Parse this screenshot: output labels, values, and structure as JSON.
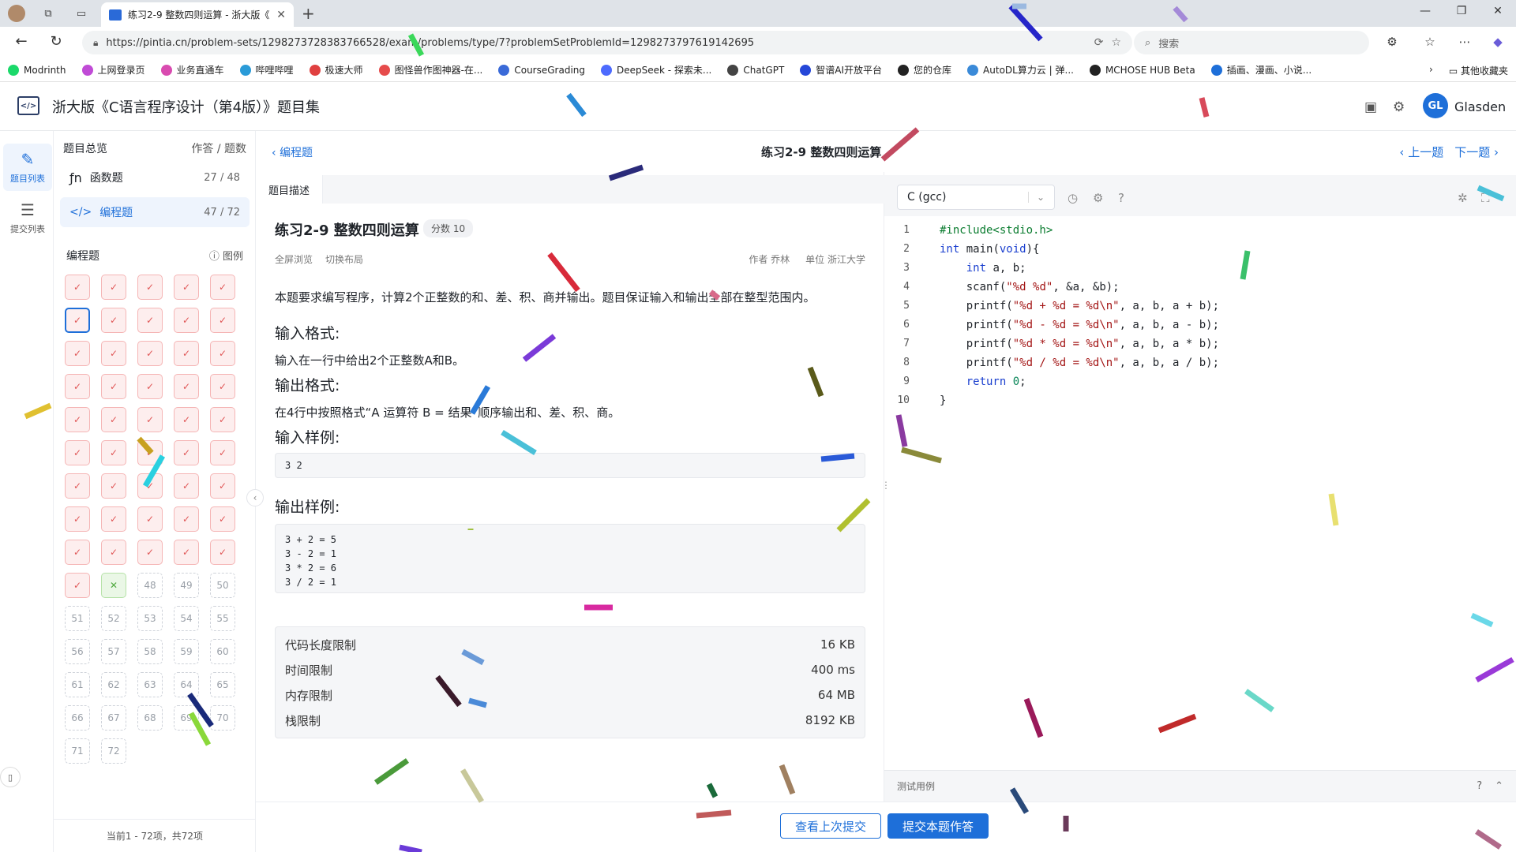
{
  "browser": {
    "tab_title": "练习2-9 整数四则运算 - 浙大版《",
    "url": "https://pintia.cn/problem-sets/1298273728383766528/exam/problems/type/7?problemSetProblemId=1298273797619142695",
    "search_placeholder": "搜索",
    "bookmarks": [
      {
        "label": "Modrinth",
        "color": "#1bd96a"
      },
      {
        "label": "上网登录页",
        "color": "#c04bd6"
      },
      {
        "label": "业务直通车",
        "color": "#d94bb0"
      },
      {
        "label": "哔哩哔哩",
        "color": "#2a9bd8"
      },
      {
        "label": "极速大师",
        "color": "#e04040"
      },
      {
        "label": "图怪兽作图神器-在...",
        "color": "#e64b4b"
      },
      {
        "label": "CourseGrading",
        "color": "#3a6ad8"
      },
      {
        "label": "DeepSeek - 探索未...",
        "color": "#4d6bfe"
      },
      {
        "label": "ChatGPT",
        "color": "#444444"
      },
      {
        "label": "智谱AI开放平台",
        "color": "#2547d8"
      },
      {
        "label": "您的仓库",
        "color": "#222222"
      },
      {
        "label": "AutoDL算力云 | 弹...",
        "color": "#3a8ad8"
      },
      {
        "label": "MCHOSE HUB Beta",
        "color": "#222222"
      },
      {
        "label": "插画、漫画、小说...",
        "color": "#1e6fd9"
      }
    ],
    "bookmarks_folder": "其他收藏夹"
  },
  "app": {
    "title": "浙大版《C语言程序设计（第4版）》题目集",
    "avatar_initials": "GL",
    "user_name": "Glasden",
    "accent_color": "#1e6fd9"
  },
  "rail": {
    "items": [
      {
        "label": "题目列表",
        "icon": "problem-list-icon"
      },
      {
        "label": "提交列表",
        "icon": "submission-list-icon"
      }
    ]
  },
  "problem_list": {
    "header": "题目总览",
    "header_right": "作答 / 题数",
    "types": [
      {
        "label": "函数题",
        "count": "27 / 48"
      },
      {
        "label": "编程题",
        "count": "47 / 72"
      }
    ],
    "grid_title": "编程题",
    "legend_label": "图例",
    "footer": "当前1 - 72项，共72项",
    "cells": [
      "pass",
      "pass",
      "pass",
      "pass",
      "pass",
      "sel",
      "pass",
      "pass",
      "pass",
      "pass",
      "pass",
      "pass",
      "pass",
      "pass",
      "pass",
      "pass",
      "pass",
      "pass",
      "pass",
      "pass",
      "pass",
      "pass",
      "pass",
      "pass",
      "pass",
      "pass",
      "pass",
      "pass",
      "pass",
      "pass",
      "pass",
      "pass",
      "pass",
      "pass",
      "pass",
      "pass",
      "pass",
      "pass",
      "pass",
      "pass",
      "pass",
      "pass",
      "pass",
      "pass",
      "pass",
      "pass",
      "fail",
      "48",
      "49",
      "50",
      "51",
      "52",
      "53",
      "54",
      "55",
      "56",
      "57",
      "58",
      "59",
      "60",
      "61",
      "62",
      "63",
      "64",
      "65",
      "66",
      "67",
      "68",
      "69",
      "70",
      "71",
      "72"
    ]
  },
  "top_strip": {
    "back": "编程题",
    "title": "练习2-9 整数四则运算",
    "prev": "上一题",
    "next": "下一题"
  },
  "description": {
    "tab": "题目描述",
    "title": "练习2-9 整数四则运算",
    "score": "分数 10",
    "fullscreen": "全屏浏览",
    "layout": "切换布局",
    "author": "作者 乔林",
    "unit": "单位 浙江大学",
    "statement": "本题要求编写程序，计算2个正整数的和、差、积、商并输出。题目保证输入和输出全部在整型范围内。",
    "input_title": "输入格式:",
    "input_text": "输入在一行中给出2个正整数A和B。",
    "output_title": "输出格式:",
    "output_text": "在4行中按照格式“A 运算符 B = 结果”顺序输出和、差、积、商。",
    "sample_in_title": "输入样例:",
    "sample_in": "3 2",
    "sample_out_title": "输出样例:",
    "sample_out": "3 + 2 = 5\n3 - 2 = 1\n3 * 2 = 6\n3 / 2 = 1",
    "limits": [
      {
        "label": "代码长度限制",
        "value": "16 KB"
      },
      {
        "label": "时间限制",
        "value": "400 ms"
      },
      {
        "label": "内存限制",
        "value": "64 MB"
      },
      {
        "label": "栈限制",
        "value": "8192 KB"
      }
    ]
  },
  "editor": {
    "language": "C (gcc)",
    "lines": [
      "#include<stdio.h>",
      "int main(void){",
      "    int a, b;",
      "    scanf(\"%d %d\", &a, &b);",
      "    printf(\"%d + %d = %d\\n\", a, b, a + b);",
      "    printf(\"%d - %d = %d\\n\", a, b, a - b);",
      "    printf(\"%d * %d = %d\\n\", a, b, a * b);",
      "    printf(\"%d / %d = %d\\n\", a, b, a / b);",
      "    return 0;",
      "}"
    ],
    "testcase_label": "测试用例"
  },
  "actions": {
    "view_last": "查看上次提交",
    "submit": "提交本题作答"
  }
}
